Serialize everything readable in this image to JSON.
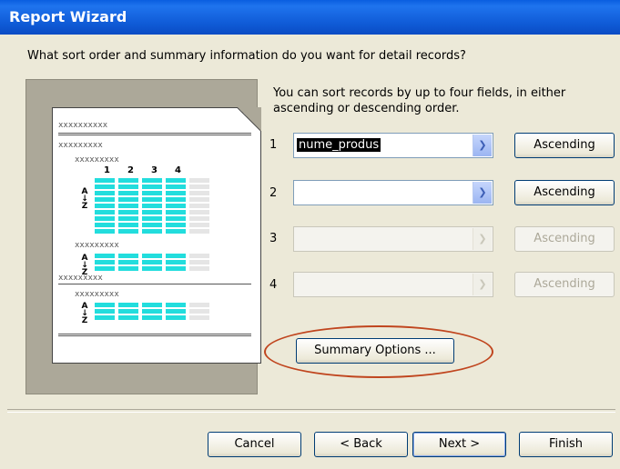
{
  "window": {
    "title": "Report Wizard"
  },
  "question": "What sort order and summary information do you want for detail records?",
  "hint": "You can sort records by up to four fields, in either ascending or descending order.",
  "preview": {
    "header_x": "xxxxxxxxxx",
    "group1_x": "xxxxxxxxx",
    "group2_x": "xxxxxxxxx",
    "col_numbers": [
      "1",
      "2",
      "3",
      "4"
    ],
    "az_top": "A",
    "az_bottom": "Z",
    "az_arrow": "↓"
  },
  "sort_rows": [
    {
      "number": "1",
      "field": "nume_produs",
      "order": "Ascending",
      "enabled": true
    },
    {
      "number": "2",
      "field": "",
      "order": "Ascending",
      "enabled": true
    },
    {
      "number": "3",
      "field": "",
      "order": "Ascending",
      "enabled": false
    },
    {
      "number": "4",
      "field": "",
      "order": "Ascending",
      "enabled": false
    }
  ],
  "summary_button": "Summary Options ...",
  "buttons": {
    "cancel": "Cancel",
    "back": "< Back",
    "next": "Next >",
    "finish": "Finish"
  },
  "colors": {
    "accent": "#0a5ee0",
    "highlight_ring": "#c0451e",
    "preview_cells": "#22dddd"
  }
}
